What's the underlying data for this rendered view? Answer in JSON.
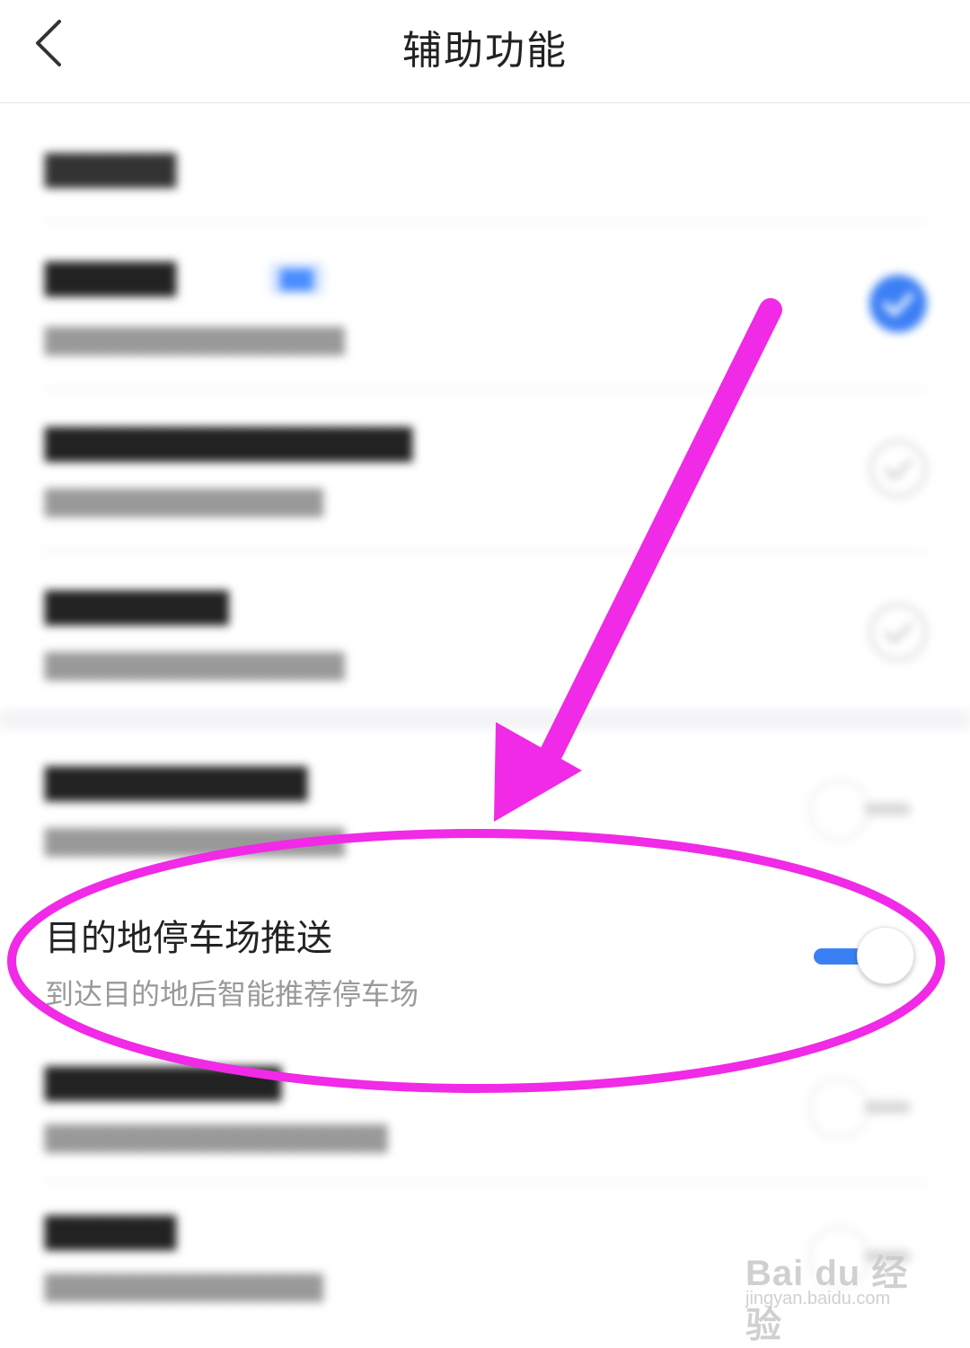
{
  "header": {
    "title": "辅助功能",
    "back_icon": "chevron-left-icon"
  },
  "focused_setting": {
    "title": "目的地停车场推送",
    "subtitle": "到达目的地后智能推荐停车场",
    "toggle_state": "on"
  },
  "colors": {
    "accent_blue": "#3b7ff5",
    "annotation_magenta": "#f02ae6"
  },
  "watermark": {
    "brand": "Bai du 经验",
    "url": "jingyan.baidu.com"
  }
}
